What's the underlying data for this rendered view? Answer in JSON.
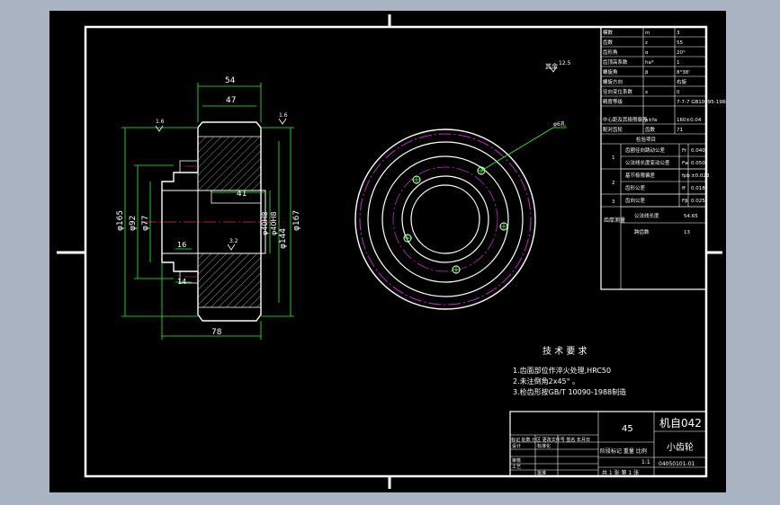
{
  "dimensions": {
    "d54": "54",
    "d47": "47",
    "d41": "41",
    "d78": "78",
    "d165": "φ165",
    "d92": "φ92",
    "d77": "φ77",
    "d140h8": "φ40H8",
    "d144": "φ144",
    "d167": "φ167",
    "d16": "16",
    "d14": "14",
    "bore": "φ40H8",
    "surf_top_left": "1.6",
    "surf_top_right": "1.6",
    "surf_bore": "3.2",
    "surf_corner": "1.6/"
  },
  "param_table": {
    "rows": [
      {
        "label": "模数",
        "sym": "m",
        "val": "3"
      },
      {
        "label": "齿数",
        "sym": "z",
        "val": "55"
      },
      {
        "label": "齿形角",
        "sym": "α",
        "val": "20°"
      },
      {
        "label": "齿顶高系数",
        "sym": "ha*",
        "val": "1"
      },
      {
        "label": "螺旋角",
        "sym": "β",
        "val": "8°38'"
      },
      {
        "label": "螺旋方向",
        "sym": "",
        "val": "右旋"
      },
      {
        "label": "径向变位系数",
        "sym": "x",
        "val": "0"
      },
      {
        "label": "精度等级",
        "sym": "",
        "val": "7-7-7 GB10095-1988"
      },
      {
        "label": "中心距及其极限偏差",
        "sym": "a±fa",
        "val": "160±0.04"
      },
      {
        "label": "配对齿轮",
        "sym": "齿数",
        "val": "71"
      }
    ],
    "tolerance_header": "检验项目",
    "groups": [
      {
        "num": "1",
        "items": [
          {
            "name": "齿圈径向跳动公差",
            "sym": "Fr",
            "val": "0.040"
          },
          {
            "name": "公法线长度变动公差",
            "sym": "Fw",
            "val": "0.050"
          }
        ]
      },
      {
        "num": "2",
        "items": [
          {
            "name": "基节极限偏差",
            "sym": "fpb",
            "val": "±0.023"
          },
          {
            "name": "齿形公差",
            "sym": "ff",
            "val": "0.018"
          }
        ]
      },
      {
        "num": "3",
        "items": [
          {
            "name": "齿向公差",
            "sym": "Fβ",
            "val": "0.025"
          }
        ]
      }
    ],
    "thickness_label": "齿厚测量",
    "thickness_items": [
      {
        "name": "公法线长度",
        "val": "54.65"
      },
      {
        "name": "跨齿数",
        "val": "13"
      }
    ]
  },
  "roughness_note": "其余",
  "roughness_value": "12.5",
  "leader_label": "φ6孔",
  "tech": {
    "title": "技 术 要 求",
    "line1": "1.齿面部位作淬火处理,HRC50",
    "line2": "2.未注倒角2x45° 。",
    "line3": "3.检齿形按GB/T 10090-1988制造"
  },
  "title_block": {
    "material": "45",
    "org": "机自042",
    "part_name": "小齿轮",
    "drawing_no": "04050101-01",
    "scale_row": "阶段标记  重量  比例",
    "scale_val": "1:1",
    "sheets": "共 1 张 第 1 张",
    "sign_header": "标记 处数 分区 更改文件号 签名 年月日",
    "designer": "设计",
    "standard": "标准化",
    "checker": "审核",
    "process": "工艺",
    "approve": "批准"
  }
}
